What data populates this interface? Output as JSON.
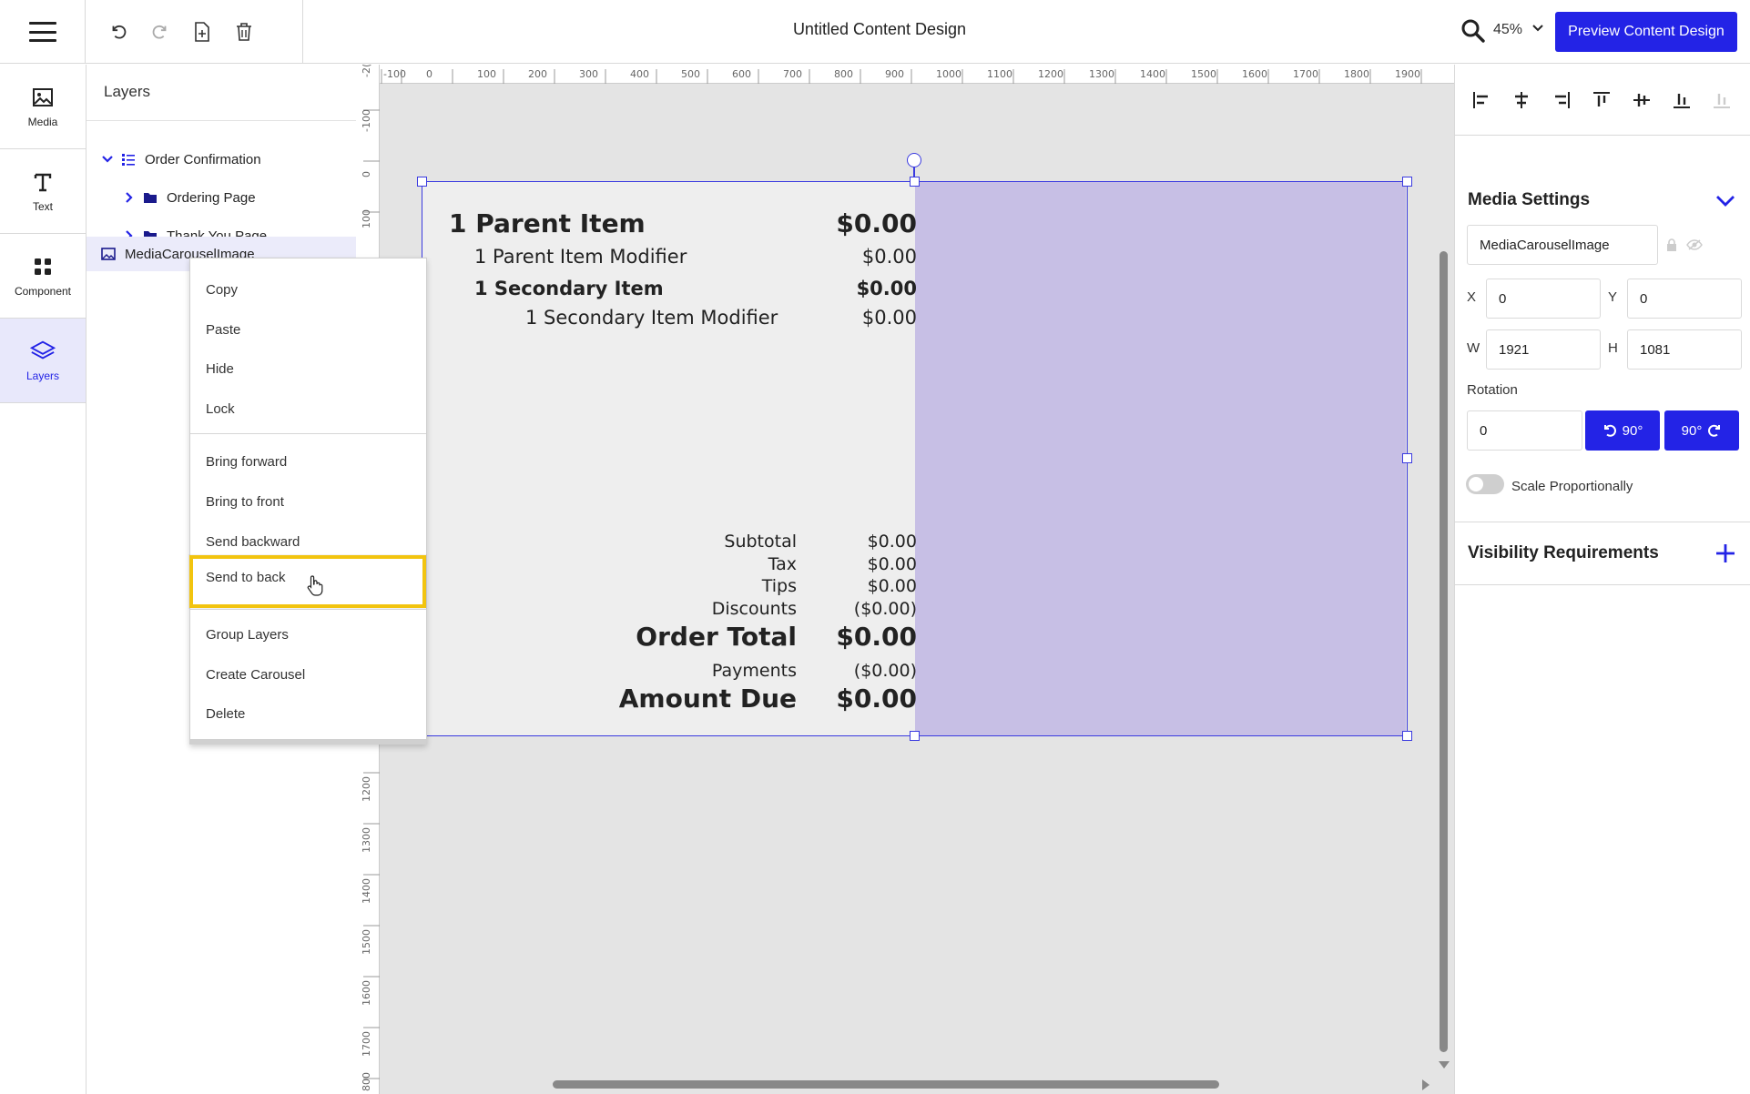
{
  "app": {
    "title": "Untitled Content Design",
    "zoom": "45%",
    "preview_label": "Preview Content Design"
  },
  "toolbar": {
    "undo": "undo-icon",
    "redo": "redo-icon",
    "new_page": "add-page-icon",
    "delete": "trash-icon"
  },
  "leftnav": {
    "items": [
      {
        "label": "Media",
        "icon": "image-icon"
      },
      {
        "label": "Text",
        "icon": "text-icon"
      },
      {
        "label": "Component",
        "icon": "grid-icon"
      },
      {
        "label": "Layers",
        "icon": "layers-icon"
      }
    ]
  },
  "layers": {
    "title": "Layers",
    "items": [
      {
        "label": "Order Confirmation",
        "expanded": true
      },
      {
        "label": "Ordering Page",
        "expanded": false
      },
      {
        "label": "Thank You Page",
        "expanded": false
      },
      {
        "label": "MediaCarouselImage",
        "selected": true
      }
    ]
  },
  "context_menu": {
    "items": [
      "Copy",
      "Paste",
      "Hide",
      "Lock",
      "Bring forward",
      "Bring to front",
      "Send backward",
      "Send to back",
      "Group Layers",
      "Create Carousel",
      "Delete"
    ],
    "highlighted": "Send to back"
  },
  "rulers": {
    "top": [
      "-100",
      "0",
      "100",
      "200",
      "300",
      "400",
      "500",
      "600",
      "700",
      "800",
      "900",
      "1000",
      "1100",
      "1200",
      "1300",
      "1400",
      "1500",
      "1600",
      "1700",
      "1800",
      "1900"
    ],
    "top_edge": "-2(",
    "left_top": [
      "-100",
      "0",
      "100"
    ],
    "left_bottom": [
      "1200",
      "1300",
      "1400",
      "1500",
      "1600",
      "1700",
      "800"
    ]
  },
  "receipt": {
    "parent_item": "1 Parent Item",
    "parent_price": "$0.00",
    "parent_modifier": "1 Parent Item Modifier",
    "parent_modifier_price": "$0.00",
    "secondary_item": "1 Secondary Item",
    "secondary_price": "$0.00",
    "secondary_modifier": "1 Secondary Item Modifier",
    "secondary_modifier_price": "$0.00",
    "subtotal_label": "Subtotal",
    "subtotal_value": "$0.00",
    "tax_label": "Tax",
    "tax_value": "$0.00",
    "tips_label": "Tips",
    "tips_value": "$0.00",
    "discounts_label": "Discounts",
    "discounts_value": "($0.00)",
    "order_total_label": "Order Total",
    "order_total_value": "$0.00",
    "payments_label": "Payments",
    "payments_value": "($0.00)",
    "amount_due_label": "Amount Due",
    "amount_due_value": "$0.00"
  },
  "media_settings": {
    "title": "Media Settings",
    "name_value": "MediaCarouselImage",
    "x_label": "X",
    "x_value": "0",
    "y_label": "Y",
    "y_value": "0",
    "w_label": "W",
    "w_value": "1921",
    "h_label": "H",
    "h_value": "1081",
    "rotation_label": "Rotation",
    "rotation_value": "0",
    "rotate_left_label": "90°",
    "rotate_right_label": "90°",
    "scale_label": "Scale Proportionally",
    "scale_on": false
  },
  "visibility": {
    "title": "Visibility Requirements"
  },
  "colors": {
    "accent": "#2323e6",
    "selection": "#3a3ae0",
    "media_fill": "#c7bfe5",
    "highlight": "#f2c40f"
  }
}
